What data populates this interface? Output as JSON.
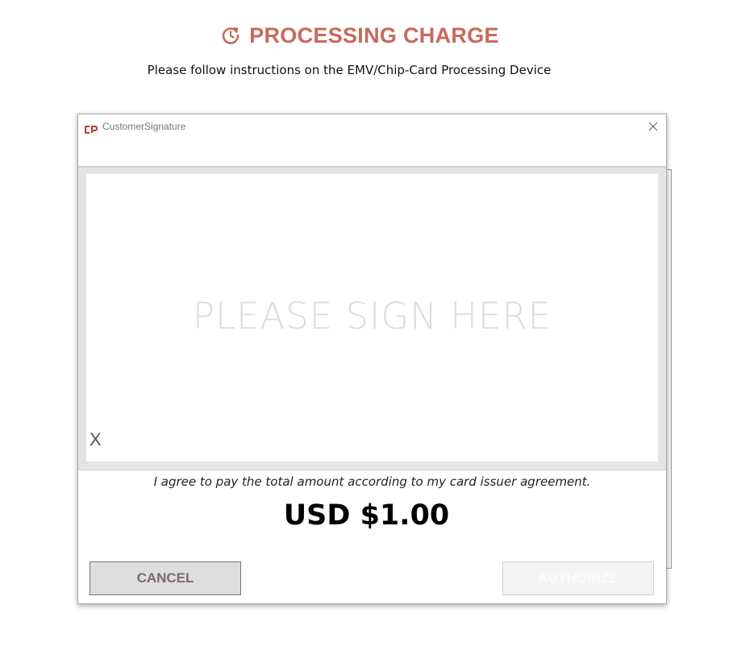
{
  "header": {
    "title": "PROCESSING CHARGE",
    "subtitle": "Please follow instructions on the EMV/Chip-Card Processing Device",
    "icon": "refresh-icon",
    "accent_color": "#c8695c"
  },
  "dialog": {
    "window_title": "CustomerSignature",
    "close_icon": "close-icon",
    "signature_placeholder": "PLEASE SIGN HERE",
    "x_mark": "X",
    "agreement_text": "I agree to pay the total amount according to my card issuer agreement.",
    "amount": "USD $1.00",
    "buttons": {
      "cancel": "CANCEL",
      "authorize": "AUTHORIZE"
    }
  }
}
